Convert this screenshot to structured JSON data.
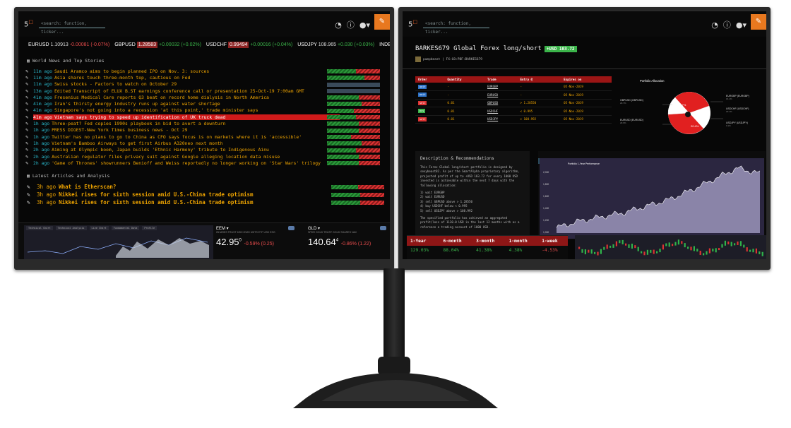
{
  "left": {
    "logo": "5",
    "logo_sup": "",
    "search_placeholder": "<search: function, ticker...",
    "ticker": [
      {
        "sym": "EURUSD",
        "price": "1.10913",
        "chg": "-0.00081 (-0.07%)",
        "dir": "neg",
        "boxed": false
      },
      {
        "sym": "GBPUSD",
        "price": "1.28583",
        "chg": "+0.00032 (+0.02%)",
        "dir": "pos",
        "boxed": true
      },
      {
        "sym": "USDCHF",
        "price": "0.99494",
        "chg": "+0.00016 (+0.04%)",
        "dir": "pos",
        "boxed": true
      },
      {
        "sym": "USDJPY",
        "price": "108.965",
        "chg": "+0.030 (+0.03%)",
        "dir": "pos",
        "boxed": false
      },
      {
        "sym": "INDEXCBOE",
        "price": "",
        "chg": "",
        "dir": "pos",
        "boxed": false
      }
    ],
    "news_title": "World News and Top Stories",
    "news": [
      {
        "ago": "11m ago",
        "title": "Saudi Aramco aims to begin planned IPO on Nov. 3: sources",
        "red": 45
      },
      {
        "ago": "11m ago",
        "title": "Asia shares touch three-month top, cautious on Fed",
        "red": 30
      },
      {
        "ago": "11m ago",
        "title": "Swiss stocks - Factors to watch on October 29",
        "red": 0
      },
      {
        "ago": "13m ago",
        "title": "Edited Transcript of ELUX B.ST earnings conference call or presentation 25-Oct-19 7:00am GMT",
        "red": 0
      },
      {
        "ago": "41m ago",
        "title": "Fresenius Medical Care reports Q3 beat on record home dialysis in North America",
        "red": 40
      },
      {
        "ago": "41m ago",
        "title": "Iran's thirsty energy industry runs up against water shortage",
        "red": 35
      },
      {
        "ago": "41m ago",
        "title": "Singapore's not going into a recession 'at this point,' trade minister says",
        "red": 50
      },
      {
        "ago": "41m ago",
        "title": "Vietnam says trying to speed up identification of UK truck dead",
        "red": 45,
        "hot": true
      },
      {
        "ago": "1h ago",
        "title": "Three-peat? Fed copies 1990s playbook in bid to avert a downturn",
        "red": 40
      },
      {
        "ago": "1h ago",
        "title": "PRESS DIGEST-New York Times business news - Oct 29",
        "red": 40
      },
      {
        "ago": "1h ago",
        "title": "Twitter has no plans to go to China as CFO says focus is on markets where it is 'accessible'",
        "red": 55
      },
      {
        "ago": "1h ago",
        "title": "Vietnam's Bamboo Airways to get first Airbus A320neo next month",
        "red": 35
      },
      {
        "ago": "2h ago",
        "title": "Aiming at Olympic boom, Japan builds 'Ethnic Harmony' tribute to Indigenous Ainu",
        "red": 45
      },
      {
        "ago": "2h ago",
        "title": "Australian regulator files privacy suit against Google alleging location data misuse",
        "red": 40
      },
      {
        "ago": "2h ago",
        "title": "'Game of Thrones' showrunners Benioff and Weiss reportedly no longer working on 'Star Wars' trilogy",
        "red": 40
      }
    ],
    "articles_title": "Latest Articles and Analysis",
    "articles": [
      {
        "ago": "3h ago",
        "title": "What is Etherscan?",
        "red": 50
      },
      {
        "ago": "3h ago",
        "title": "Nikkei rises for sixth session amid U.S.-China trade optimism",
        "red": 45
      },
      {
        "ago": "3h ago",
        "title": "Nikkei rises for sixth session amid U.S.-China trade optimism",
        "red": 45
      }
    ],
    "mini_tabs": [
      "Technical Chart",
      "Technical Analysis",
      "Live Chart",
      "Fundamental Data",
      "Profile"
    ],
    "quotes": [
      {
        "sym": "EEM ▾",
        "name": "ISHARES TRUST MSCI EMG MKTS ETF USD ESG",
        "price": "42.95",
        "price_sup": "0",
        "chg": "-0.59% (0.25)",
        "dir": "neg"
      },
      {
        "sym": "GLD ▾",
        "name": "SPDR GOLD TRUST GOLD SHARES NAV",
        "price": "140.64",
        "price_sup": "4",
        "chg": "-0.86% (1.22)",
        "dir": "neg"
      }
    ]
  },
  "right": {
    "logo": "5",
    "search_placeholder": "<search: function, ticker...",
    "title": "BARKES679 Global Forex long/short",
    "badge": "+USD 103.72",
    "author": "pumpbeast | FX:GO:PBF:BARKES679",
    "orders": {
      "headers": [
        "Order",
        "Quantity",
        "Trade",
        "Entry @",
        "Expires on"
      ],
      "rows": [
        {
          "tag": "wait",
          "tagtype": "wait",
          "qty": "-",
          "trade": "EURGBP",
          "entry": "-",
          "exp": "05-Nov-2019"
        },
        {
          "tag": "wait",
          "tagtype": "wait",
          "qty": "-",
          "trade": "EURUSD",
          "entry": "-",
          "exp": "05-Nov-2019"
        },
        {
          "tag": "sell",
          "tagtype": "sell",
          "qty": "0.01",
          "trade": "GBPUSD",
          "entry": "> 1.28550",
          "exp": "05-Nov-2019"
        },
        {
          "tag": "buy",
          "tagtype": "buy",
          "qty": "0.01",
          "trade": "USDCHF",
          "entry": "< 0.995",
          "exp": "05-Nov-2019"
        },
        {
          "tag": "sell",
          "tagtype": "sell",
          "qty": "0.01",
          "trade": "USDJPY",
          "entry": "> 108.992",
          "exp": "05-Nov-2019"
        }
      ]
    },
    "allocation": {
      "title": "Portfolio Allocation",
      "labels": [
        {
          "name": "GBPUSD (GBPUSD)",
          "val": "29.7%"
        },
        {
          "name": "EURUSD (EURUSD)",
          "val": "29.9%"
        },
        {
          "name": "EURGBP (EURGBP)",
          "val": "16.1%"
        },
        {
          "name": "USDCHF (USDCHF)",
          "val": "20.1%"
        },
        {
          "name": "USDJPY (USDJPY)",
          "val": "0.1%"
        }
      ],
      "slice_labels": [
        "29.7%",
        "20.4%"
      ]
    },
    "description": {
      "title": "Description & Recommendations",
      "body": "This Forex Global long/short portfolio is designed by sexybeast82. As per the SmartAlpha proprietary algorithm, projected profit of up to +USD 103.72 for every 1000 USD invested is achievable within the next 7 days with the following allocation:",
      "steps": [
        "1) wait EURGBP",
        "2) wait EURUSD",
        "3) sell GBPUSD above > 1.28550",
        "4) buy USDCHF below < 0.995",
        "5) sell USDJPY above > 108.992"
      ],
      "footer": "The specified portfolio has achieved an aggregated profit/loss of 1130.0 USD in the last 12 months with as a reference a trading account of 1000 USD."
    },
    "performance": {
      "tab": "Performance",
      "title": "Portfolio 1-Year Performance",
      "y_ticks": [
        "2,000",
        "1,800",
        "1,600",
        "1,400",
        "1,200",
        "1,000"
      ],
      "x_ticks": [
        "January 2019",
        "April 2019",
        "July 2019",
        "October 2019"
      ]
    },
    "returns": {
      "headers": [
        "1-Year",
        "6-month",
        "3-month",
        "1-month",
        "1-week"
      ],
      "values": [
        "129.03%",
        "88.04%",
        "41.38%",
        "4.38%",
        "-4.53%"
      ],
      "dirs": [
        "pos",
        "pos",
        "pos",
        "pos",
        "neg"
      ]
    }
  },
  "chart_data": {
    "type": "area",
    "title": "Portfolio 1-Year Performance",
    "xlabel": "",
    "ylabel": "",
    "x": [
      "January 2019",
      "April 2019",
      "July 2019",
      "October 2019"
    ],
    "series": [
      {
        "values": [
          1000,
          1120,
          1200,
          1280,
          1400,
          1520,
          1700,
          1900,
          2100,
          2000
        ]
      }
    ],
    "ylim": [
      900,
      2100
    ]
  }
}
